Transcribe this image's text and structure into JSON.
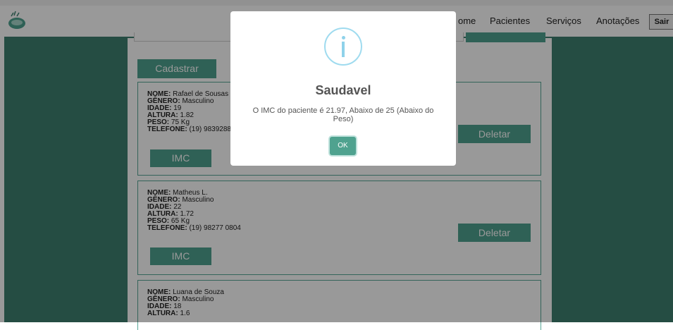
{
  "nav": {
    "home": "ome",
    "items": [
      "Pacientes",
      "Serviços",
      "Anotações"
    ],
    "sair": "Sair"
  },
  "main": {
    "cadastrar": "Cadastrar"
  },
  "labels": {
    "nome": "NOME:",
    "genero": "GÊNERO:",
    "idade": "IDADE:",
    "altura": "ALTURA:",
    "peso": "PESO:",
    "telefone": "TELEFONE:"
  },
  "patients": [
    {
      "nome": "Rafael de Sousas",
      "genero": "Masculino",
      "idade": "19",
      "altura": "1.82",
      "peso": "75 Kg",
      "telefone": "(19) 9839288",
      "imc": "IMC",
      "deletar": "Deletar"
    },
    {
      "nome": "Matheus L.",
      "genero": "Masculino",
      "idade": "22",
      "altura": "1.72",
      "peso": "65 Kg",
      "telefone": "(19) 98277 0804",
      "imc": "IMC",
      "deletar": "Deletar"
    },
    {
      "nome": "Luana de Souza",
      "genero": "Masculino",
      "idade": "18",
      "altura": "1.6"
    }
  ],
  "modal": {
    "icon": "info-icon",
    "title": "Saudavel",
    "message": "O IMC do paciente é 21.97, Abaixo de 25 (Abaixo do Peso)",
    "ok": "OK"
  },
  "colors": {
    "brand_green": "#3e8070",
    "button_green": "#4fa28f",
    "info_blue": "#9fdbef"
  }
}
